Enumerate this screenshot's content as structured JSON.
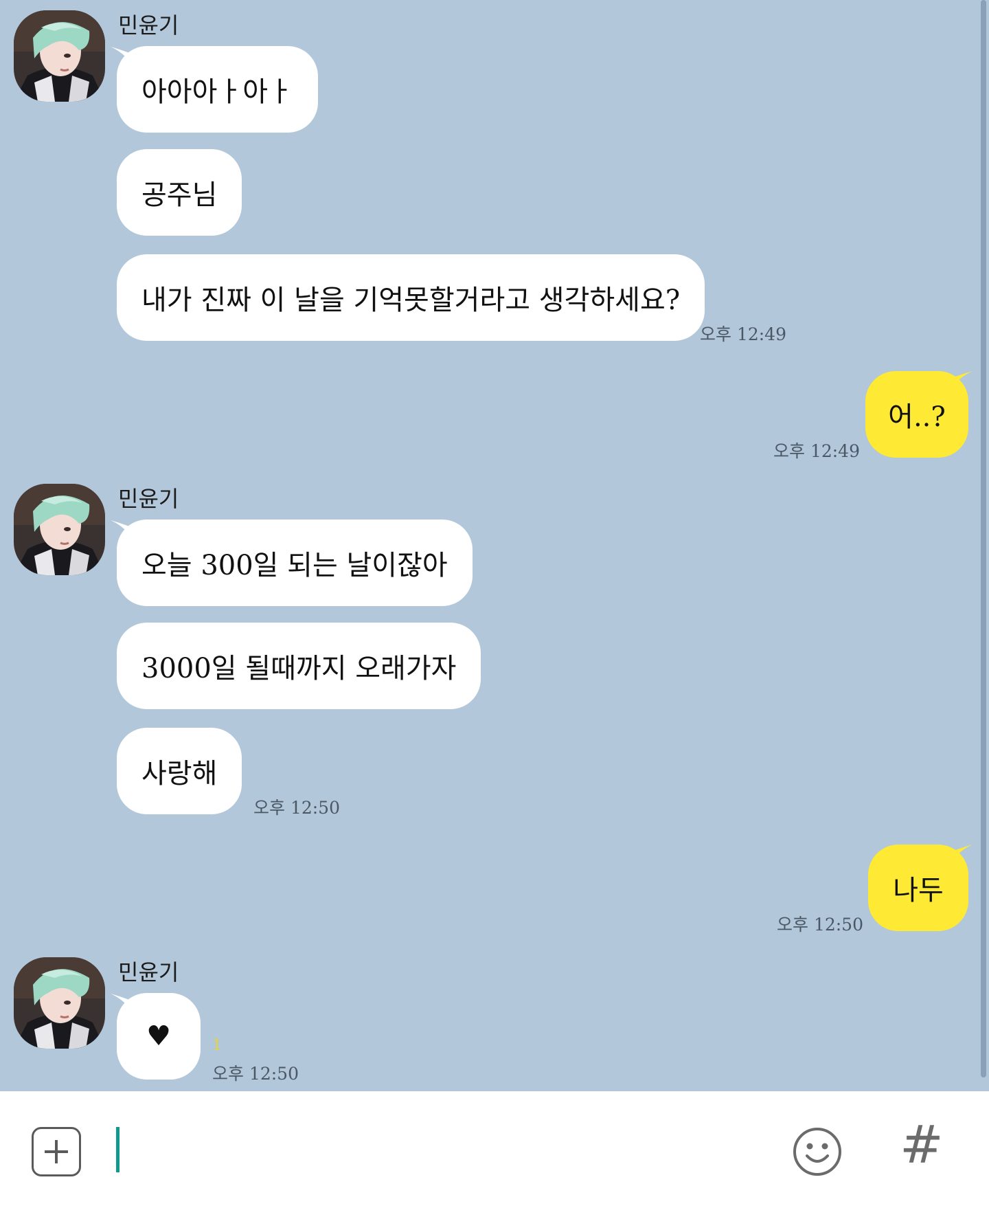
{
  "colors": {
    "chat_background": "#b2c7da",
    "incoming_bubble": "#ffffff",
    "outgoing_bubble": "#fee934",
    "cursor": "#10998d",
    "unread_count": "#e8d33b"
  },
  "contact": {
    "name": "민윤기"
  },
  "messages": {
    "group1": {
      "sender": "민윤기",
      "bubble1": "아아아ㅏ아ㅏ",
      "bubble2": "공주님",
      "bubble3": "내가 진짜 이 날을 기억못할거라고 생각하세요?",
      "time": "오후 12:49"
    },
    "mine1": {
      "text": "어..?",
      "time": "오후 12:49"
    },
    "group2": {
      "sender": "민윤기",
      "bubble1": "오늘 300일 되는 날이잖아",
      "bubble2": "3000일 될때까지 오래가자",
      "bubble3": "사랑해",
      "time": "오후 12:50"
    },
    "mine2": {
      "text": "나두",
      "time": "오후 12:50"
    },
    "group3": {
      "sender": "민윤기",
      "bubble1": "♥",
      "unread": "1",
      "time": "오후 12:50"
    }
  },
  "input_bar": {
    "plus_icon": "plus-square-icon",
    "emoji_icon": "smiley-icon",
    "hash_label": "#"
  }
}
